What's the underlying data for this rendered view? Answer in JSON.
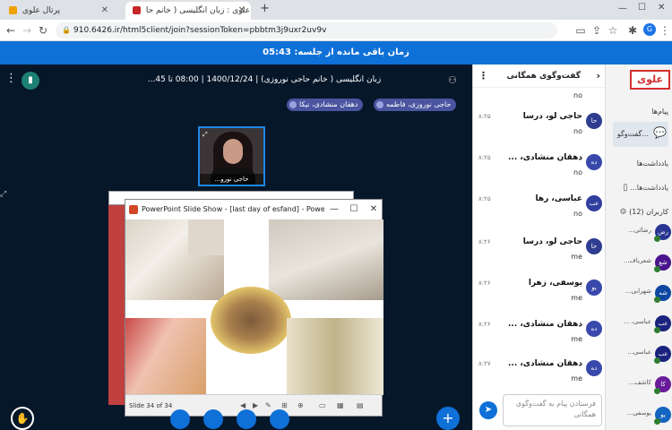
{
  "browser": {
    "tabs": [
      {
        "label": "پرتال علوی"
      },
      {
        "label": "علوی : زبان انگلیسی ( خانم حا..."
      }
    ],
    "new_tab": "+",
    "url": "910.6426.ir/html5client/join?sessionToken=pbbtm3j9uxr2uv9v",
    "profile_initial": "G"
  },
  "timer": {
    "label": "زمان باقی مانده از جلسه: 05:43"
  },
  "presentation": {
    "title": "زبان انگلیسی ( خانم حاجی نوروزی) | 1400/12/24 | 08:00 تا 45...",
    "talkers": [
      "حاجی نوروزی، فاطمه",
      "دهقان منشادی، نیکا"
    ],
    "webcam_caption": "حاجی نورو...",
    "ppt_title": "PowerPoint Slide Show - [last day of esfand] - PowerPoint",
    "ppt_status": "Slide 34 of 34",
    "window_controls": {
      "minimize": "—",
      "restore": "☐",
      "close": "✕"
    },
    "plus_label": "+"
  },
  "chat": {
    "header": "گفت‌وگوی همگانی",
    "messages": [
      {
        "initials": "",
        "name": "",
        "time": "",
        "text": "no"
      },
      {
        "initials": "حا",
        "name": "حاجی لو، درسا",
        "time": "۸:۲۵",
        "text": "no"
      },
      {
        "initials": "ده",
        "name": "دهقان منشادی، ...",
        "time": "۸:۲۵",
        "text": "no"
      },
      {
        "initials": "عب",
        "name": "عباسی، رها",
        "time": "۸:۲۵",
        "text": "no"
      },
      {
        "initials": "حا",
        "name": "حاجی لو، درسا",
        "time": "۸:۲۶",
        "text": "me"
      },
      {
        "initials": "یو",
        "name": "یوسفی، زهرا",
        "time": "۸:۲۶",
        "text": "me"
      },
      {
        "initials": "ده",
        "name": "دهقان منشادی، ...",
        "time": "۸:۲۶",
        "text": "me"
      },
      {
        "initials": "ده",
        "name": "دهقان منشادی، ...",
        "time": "۸:۲۷",
        "text": "me"
      }
    ],
    "input_placeholder": "فرستادن پیام به گفت‌وگوی همگانی"
  },
  "sidebar": {
    "logo": "علوی",
    "messages_heading": "پیام‌ها",
    "public_chat": "گفت‌وگو...",
    "notes_heading": "یادداشت‌ها",
    "shared_notes": "یادداشت‌ها...",
    "users_heading": "کاربران (12)",
    "users": [
      {
        "initials": "رض",
        "name": "رضائی..."
      },
      {
        "initials": "شع",
        "name": "شعرباف..."
      },
      {
        "initials": "شه",
        "name": "شهرابی..."
      },
      {
        "initials": "عب",
        "name": "عباسی، ..."
      },
      {
        "initials": "عب",
        "name": "عباسی..."
      },
      {
        "initials": "کا",
        "name": "کاشف..."
      },
      {
        "initials": "یو",
        "name": "یوسفی..."
      }
    ]
  }
}
